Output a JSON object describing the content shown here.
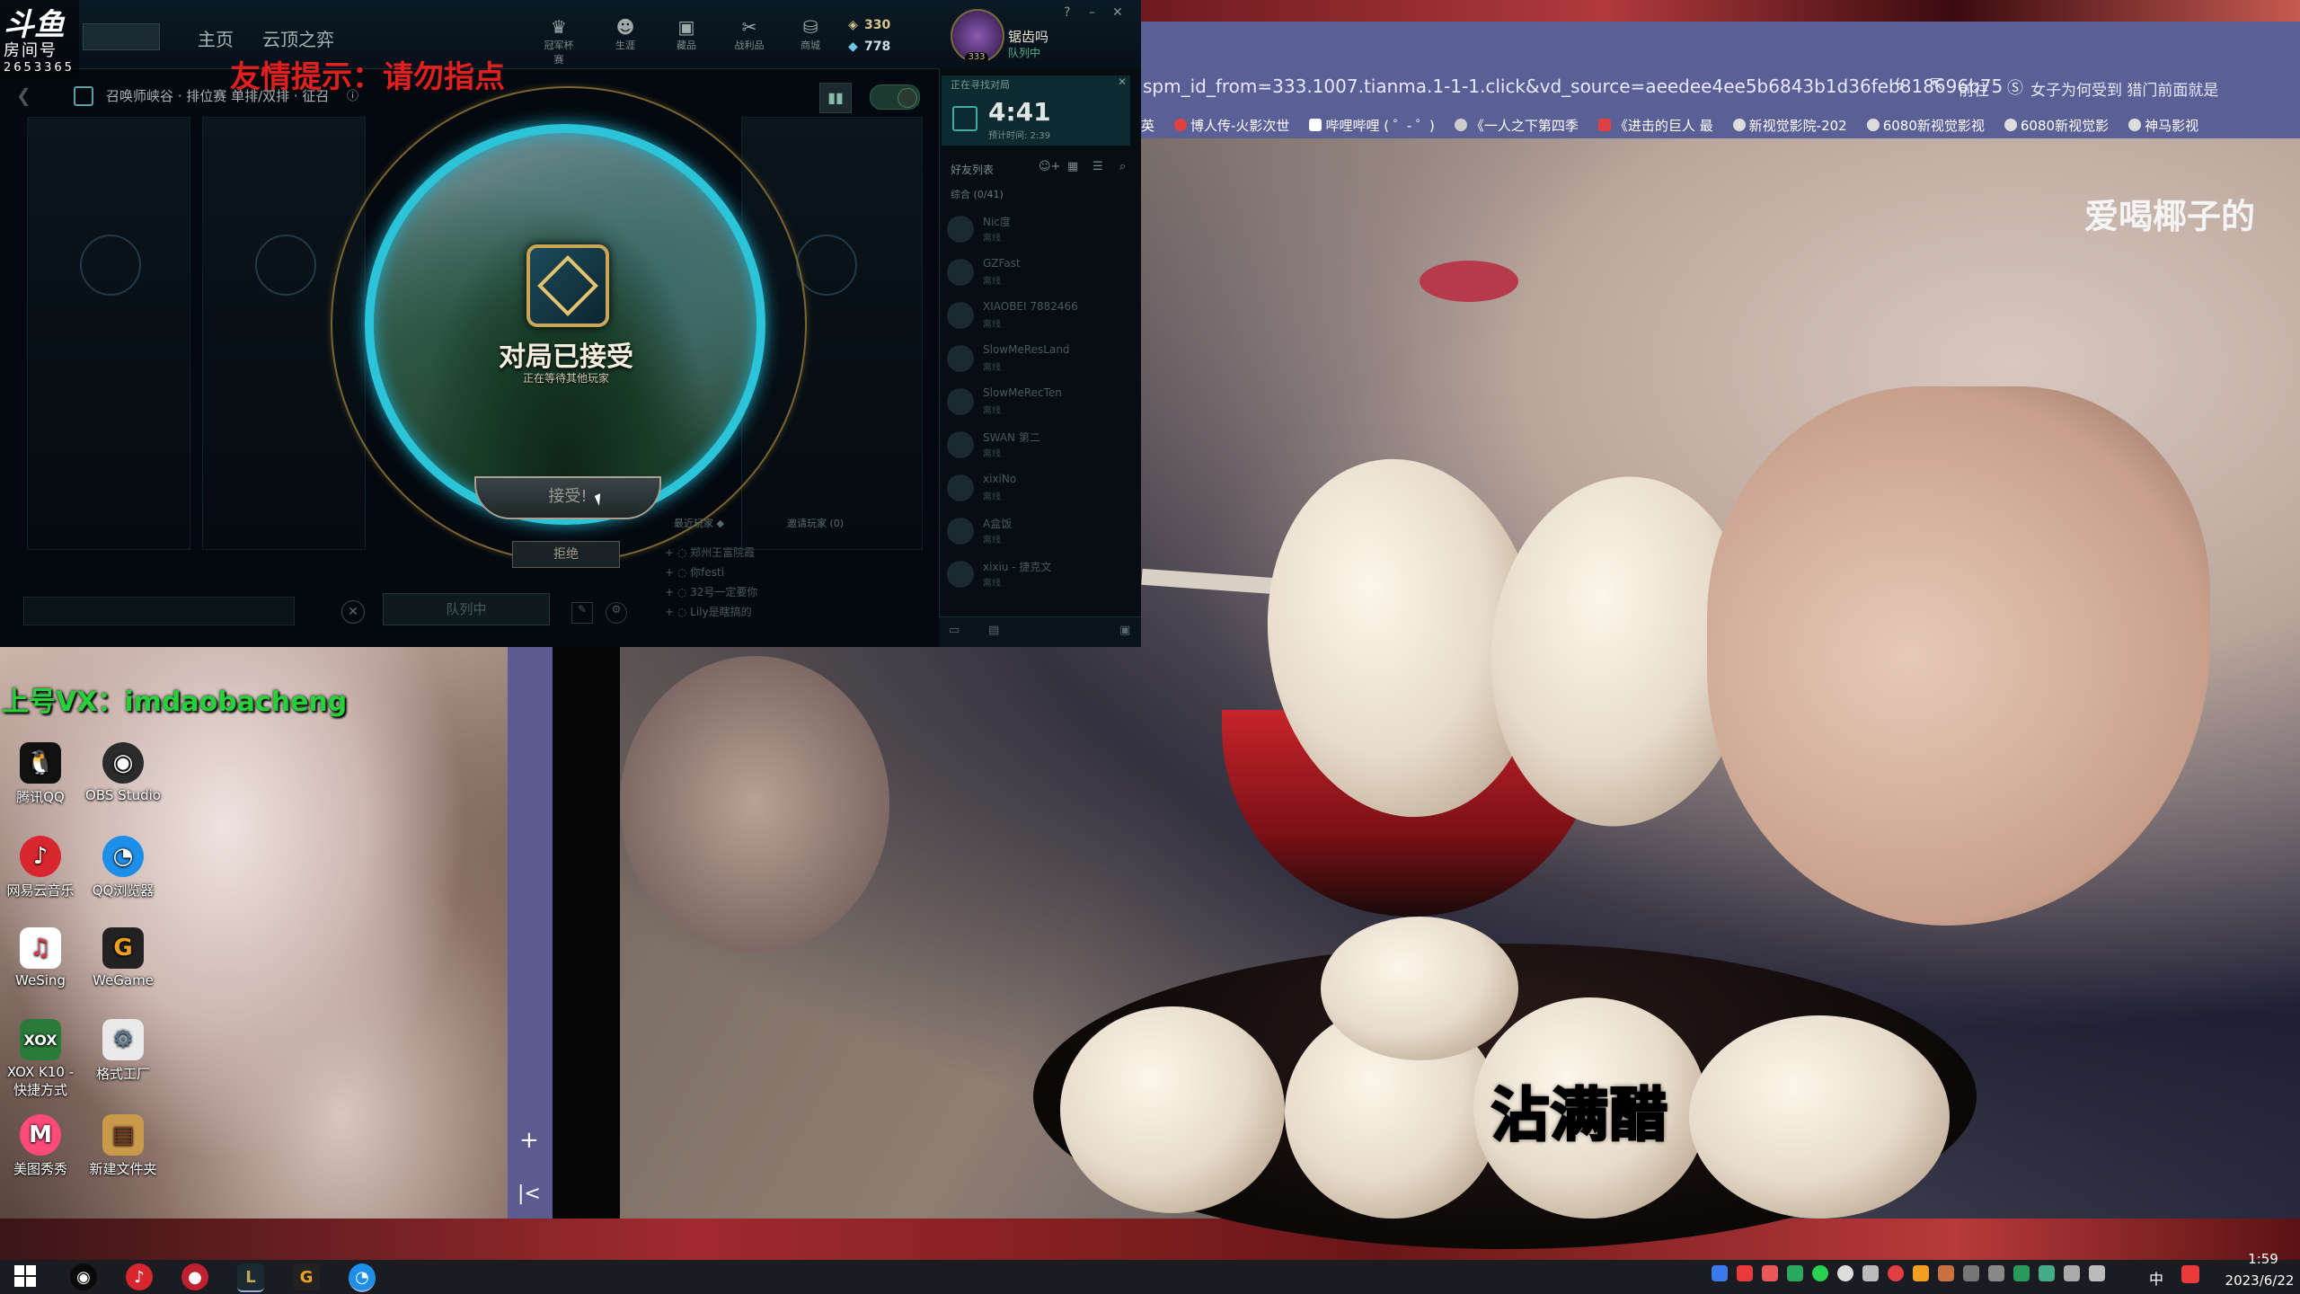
{
  "stream_overlay": {
    "brand": "斗鱼",
    "room_label": "房间号",
    "room_number": "2653365",
    "warning": "友情提示：请勿指点",
    "vx": "上号VX：imdaobacheng"
  },
  "lol": {
    "nav": {
      "home": "主页",
      "tft": "云顶之弈"
    },
    "nav_icons": [
      {
        "label": "冠军杯赛",
        "icon": "trophy-icon"
      },
      {
        "label": "生涯",
        "icon": "profile-icon"
      },
      {
        "label": "藏品",
        "icon": "collection-icon"
      },
      {
        "label": "战利品",
        "icon": "loot-icon"
      },
      {
        "label": "商城",
        "icon": "store-icon"
      }
    ],
    "currency": {
      "rp": "330",
      "be": "778"
    },
    "profile": {
      "name": "锯齿吗",
      "status": "队列中",
      "level": "333"
    },
    "queue_label": "召唤师峡谷 · 排位赛 单排/双排 · 征召",
    "ready_check": {
      "title": "对局已接受",
      "subtitle": "正在等待其他玩家",
      "accept": "接受!",
      "decline": "拒绝"
    },
    "queue_button": "队列中",
    "right_panel": {
      "status_label": "正在寻找对局",
      "timer": "4:41",
      "estimate": "预计时间: 2:39",
      "friends_header": "好友列表",
      "group": "综合 (0/41)",
      "friends": [
        {
          "name": "Nic度",
          "status": "离线"
        },
        {
          "name": "GZFast",
          "status": "离线"
        },
        {
          "name": "XIAOBEI 7882466",
          "status": "离线"
        },
        {
          "name": "SlowMeResLand",
          "status": "离线"
        },
        {
          "name": "SlowMeRecTen",
          "status": "离线"
        },
        {
          "name": "SWAN 第二",
          "status": "离线"
        },
        {
          "name": "xixiNo",
          "status": "离线"
        },
        {
          "name": "A盒饭",
          "status": "离线"
        },
        {
          "name": "xixiu - 捷克文",
          "status": "离线"
        }
      ],
      "recent_header": "最近玩家 ◆",
      "invite_header": "邀请玩家 (0)",
      "recent": [
        "郑州王富院霞",
        "你festi",
        "32号一定要你",
        "Lily是瞎搞的"
      ]
    }
  },
  "video": {
    "url": "spm_id_from=333.1007.tianma.1-1-1.click&vd_source=aeedee4ee5b6843b1d36feb818696b75",
    "forward": "前往",
    "search_suggest": "女子为何受到 猎门前面就是",
    "bookmarks": [
      "英",
      "博人传-火影次世",
      "哔哩哔哩 ( ゜- ゜)",
      "《一人之下第四季",
      "《进击的巨人 最",
      "新视觉影院-202",
      "6080新视觉影视",
      "6080新视觉影",
      "神马影视"
    ],
    "caption": "沾满醋",
    "watermark": "爱喝椰子的"
  },
  "desktop": {
    "icons": [
      {
        "label": "腾讯QQ",
        "icon": "qq-icon",
        "color": "#111111"
      },
      {
        "label": "OBS Studio",
        "icon": "obs-icon",
        "color": "#2b2b2b"
      },
      {
        "label": "网易云音乐",
        "icon": "netease-music-icon",
        "color": "#d8262f"
      },
      {
        "label": "QQ浏览器",
        "icon": "qq-browser-icon",
        "color": "#1e8fe8"
      },
      {
        "label": "WeSing",
        "icon": "wesing-icon",
        "color": "#e8344a"
      },
      {
        "label": "WeGame",
        "icon": "wegame-icon",
        "color": "#222222"
      },
      {
        "label": "XOX K10 - 快捷方式",
        "icon": "xox-icon",
        "color": "#2a7a3a"
      },
      {
        "label": "格式工厂",
        "icon": "format-factory-icon",
        "color": "#5a7a9a"
      },
      {
        "label": "美图秀秀",
        "icon": "meitu-icon",
        "color": "#ff4a7a"
      },
      {
        "label": "新建文件夹",
        "icon": "folder-icon",
        "color": "#c99a4a"
      }
    ]
  },
  "taskbar": {
    "clock_time": "1:59",
    "clock_date": "2023/6/22",
    "ime": "中"
  }
}
